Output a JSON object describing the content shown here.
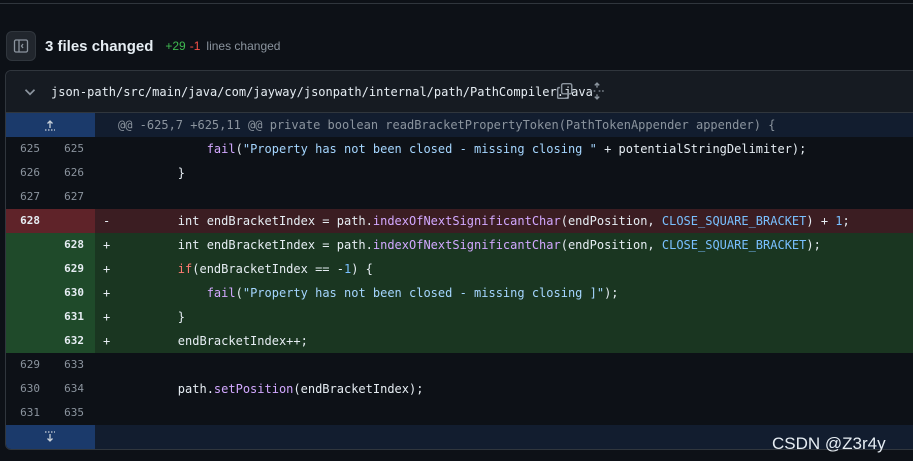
{
  "header": {
    "title": "3 files changed",
    "additions": "+29",
    "deletions": "-1",
    "lines_changed": "lines changed"
  },
  "file": {
    "path": "json-path/src/main/java/com/jayway/jsonpath/internal/path/PathCompiler.java"
  },
  "hunk": {
    "text": "@@ -625,7 +625,11 @@ private boolean readBracketPropertyToken(PathTokenAppender appender) {"
  },
  "rows": [
    {
      "old": "625",
      "new": "625",
      "marker": "",
      "tokens": [
        {
          "t": "            "
        },
        {
          "t": "fail",
          "c": "fn"
        },
        {
          "t": "("
        },
        {
          "t": "\"Property has not been closed - missing closing \"",
          "c": "str"
        },
        {
          "t": " + potentialStringDelimiter);"
        }
      ]
    },
    {
      "old": "626",
      "new": "626",
      "marker": "",
      "tokens": [
        {
          "t": "        }"
        }
      ]
    },
    {
      "old": "627",
      "new": "627",
      "marker": "",
      "tokens": [
        {
          "t": ""
        }
      ]
    },
    {
      "old": "628",
      "new": "",
      "marker": "-",
      "type": "del",
      "tokens": [
        {
          "t": "        int endBracketIndex = path."
        },
        {
          "t": "indexOfNextSignificantChar",
          "c": "fn"
        },
        {
          "t": "(endPosition, "
        },
        {
          "t": "CLOSE_SQUARE_BRACKET",
          "c": "const"
        },
        {
          "t": ") + "
        },
        {
          "t": "1",
          "c": "const"
        },
        {
          "t": ";"
        }
      ]
    },
    {
      "old": "",
      "new": "628",
      "marker": "+",
      "type": "add",
      "tokens": [
        {
          "t": "        int endBracketIndex = path."
        },
        {
          "t": "indexOfNextSignificantChar",
          "c": "fn"
        },
        {
          "t": "(endPosition, "
        },
        {
          "t": "CLOSE_SQUARE_BRACKET",
          "c": "const"
        },
        {
          "t": ");"
        }
      ]
    },
    {
      "old": "",
      "new": "629",
      "marker": "+",
      "type": "add",
      "tokens": [
        {
          "t": "        "
        },
        {
          "t": "if",
          "c": "kw"
        },
        {
          "t": "(endBracketIndex == -"
        },
        {
          "t": "1",
          "c": "const"
        },
        {
          "t": ") {"
        }
      ]
    },
    {
      "old": "",
      "new": "630",
      "marker": "+",
      "type": "add",
      "tokens": [
        {
          "t": "            "
        },
        {
          "t": "fail",
          "c": "fn"
        },
        {
          "t": "("
        },
        {
          "t": "\"Property has not been closed - missing closing ]\"",
          "c": "str"
        },
        {
          "t": ");"
        }
      ]
    },
    {
      "old": "",
      "new": "631",
      "marker": "+",
      "type": "add",
      "tokens": [
        {
          "t": "        }"
        }
      ]
    },
    {
      "old": "",
      "new": "632",
      "marker": "+",
      "type": "add",
      "tokens": [
        {
          "t": "        endBracketIndex++;"
        }
      ]
    },
    {
      "old": "629",
      "new": "633",
      "marker": "",
      "tokens": [
        {
          "t": ""
        }
      ]
    },
    {
      "old": "630",
      "new": "634",
      "marker": "",
      "tokens": [
        {
          "t": "        path."
        },
        {
          "t": "setPosition",
          "c": "fn"
        },
        {
          "t": "(endBracketIndex);"
        }
      ]
    },
    {
      "old": "631",
      "new": "635",
      "marker": "",
      "tokens": [
        {
          "t": ""
        }
      ]
    }
  ],
  "watermark": "CSDN @Z3r4y",
  "icons": {
    "toggle": "sidebar-toggle-icon",
    "chevron": "chevron-down-icon",
    "copy": "copy-icon",
    "expand": "unfold-icon",
    "expand_up": "expand-up-icon",
    "expand_down": "expand-down-icon"
  },
  "colors": {
    "additions": "#3fb950",
    "deletions": "#f85149",
    "added_bg": "#1a3621",
    "deleted_bg": "#3b1d22",
    "hunk_bg": "#121d2f"
  }
}
